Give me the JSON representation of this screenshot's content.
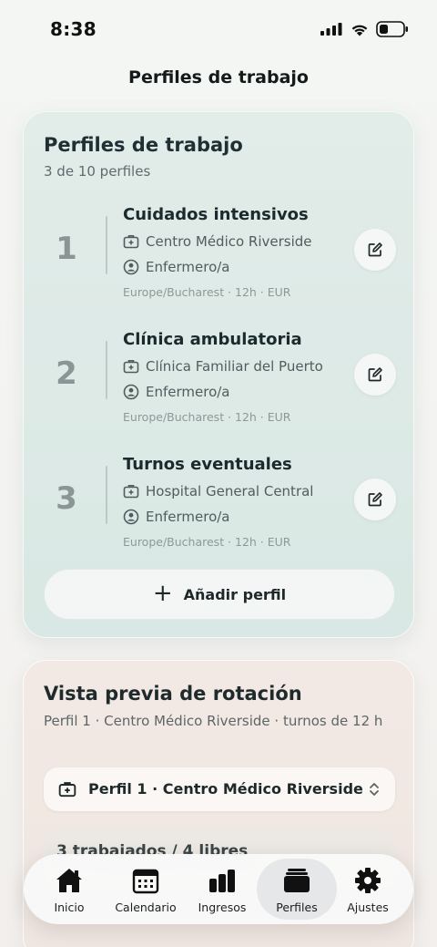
{
  "status_bar": {
    "time": "8:38"
  },
  "nav": {
    "title": "Perfiles de trabajo"
  },
  "profiles_card": {
    "title": "Perfiles de trabajo",
    "subtitle": "3 de 10 perfiles",
    "profiles": [
      {
        "number": "1",
        "name": "Cuidados intensivos",
        "facility": "Centro Médico Riverside",
        "role": "Enfermero/a",
        "meta": "Europe/Bucharest · 12h · EUR"
      },
      {
        "number": "2",
        "name": "Clínica ambulatoria",
        "facility": "Clínica Familiar del Puerto",
        "role": "Enfermero/a",
        "meta": "Europe/Bucharest · 12h · EUR"
      },
      {
        "number": "3",
        "name": "Turnos eventuales",
        "facility": "Hospital General Central",
        "role": "Enfermero/a",
        "meta": "Europe/Bucharest · 12h · EUR"
      }
    ],
    "add_button_label": "Añadir perfil"
  },
  "preview_card": {
    "title": "Vista previa de rotación",
    "subtitle": "Perfil 1 · Centro Médico Riverside · turnos de 12 h",
    "selected_profile": "Perfil 1 · Centro Médico Riverside",
    "summary": "3 trabajados / 4 libres"
  },
  "tab_bar": {
    "tabs": [
      {
        "label": "Inicio",
        "icon": "home-icon",
        "active": false
      },
      {
        "label": "Calendario",
        "icon": "calendar-icon",
        "active": false
      },
      {
        "label": "Ingresos",
        "icon": "bar-chart-icon",
        "active": false
      },
      {
        "label": "Perfiles",
        "icon": "stack-icon",
        "active": true
      },
      {
        "label": "Ajustes",
        "icon": "gear-icon",
        "active": false
      }
    ]
  }
}
